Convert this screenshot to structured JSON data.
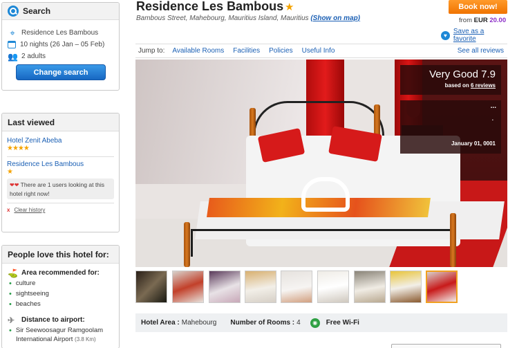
{
  "search": {
    "title": "Search",
    "hotel": "Residence Les Bambous",
    "dates": "10 nights (26 Jan – 05 Feb)",
    "guests": "2 adults",
    "button": "Change search"
  },
  "last_viewed": {
    "title": "Last viewed",
    "items": [
      {
        "name": "Hotel Zenit Abeba",
        "stars": "★★★★"
      },
      {
        "name": "Residence Les Bambous",
        "stars": "★"
      }
    ],
    "notice": "There are 1 users looking at this hotel right now!",
    "clear": "Clear history"
  },
  "people_love": {
    "title": "People love this hotel for:",
    "area_title": "Area recommended for:",
    "areas": [
      "culture",
      "sightseeing",
      "beaches"
    ],
    "airport_title": "Distance to airport:",
    "airport_name": "Sir Seewoosagur Ramgoolam",
    "airport_name2": "International Airport",
    "airport_dist": "(3.8 Km)"
  },
  "hotel": {
    "name": "Residence Les Bambous",
    "star": "★",
    "address": "Bambous Street, Mahebourg, Mauritius Island, Mauritius",
    "map_link": "(Show on map)"
  },
  "booking": {
    "book_label": "Book now!",
    "from_label": "from",
    "currency": "EUR",
    "amount": "20.00",
    "save_label": "Save as a favorite"
  },
  "jump": {
    "label": "Jump to:",
    "links": [
      "Available Rooms",
      "Facilities",
      "Policies",
      "Useful Info"
    ],
    "see_all": "See all reviews"
  },
  "rating": {
    "score_text": "Very Good 7.9",
    "based_prefix": "based on",
    "reviews_link": "6 reviews",
    "dots": "...",
    "dot": ".",
    "review_date": "January 01, 0001"
  },
  "info": {
    "area_label": "Hotel Area :",
    "area_value": "Mahebourg",
    "rooms_label": "Number of Rooms :",
    "rooms_value": "4",
    "wifi": "Free Wi-Fi"
  },
  "colors": {
    "brand_blue": "#1e88d6",
    "book_orange": "#f07300",
    "price_purple": "#8a2bc7",
    "star_gold": "#f5a300"
  }
}
